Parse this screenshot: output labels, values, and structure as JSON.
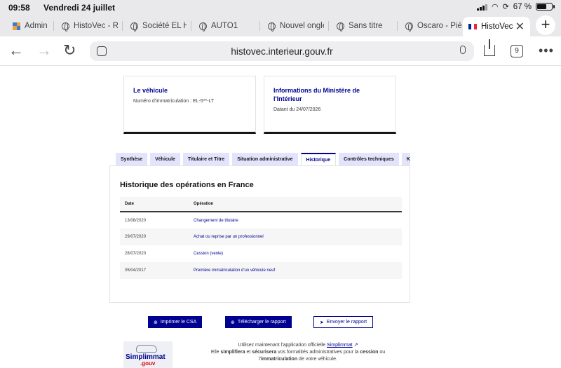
{
  "status_bar": {
    "time": "09:58",
    "date": "Vendredi 24 juillet",
    "battery": "67 %"
  },
  "browser": {
    "tabs": [
      {
        "label": "Admin",
        "icon": "admin-favicon"
      },
      {
        "label": "HistoVec - R",
        "icon": "globe-icon"
      },
      {
        "label": "Société EL H",
        "icon": "globe-icon"
      },
      {
        "label": "AUTO1",
        "icon": "globe-icon"
      },
      {
        "label": "Nouvel ongle",
        "icon": "globe-icon"
      },
      {
        "label": "Sans titre",
        "icon": "globe-icon"
      },
      {
        "label": "Oscaro - Pié",
        "icon": "globe-icon"
      },
      {
        "label": "HistoVec",
        "icon": "french-flag-icon",
        "active": true
      }
    ],
    "url": "histovec.interieur.gouv.fr",
    "tab_count": "9"
  },
  "cards": {
    "vehicle": {
      "title": "Le véhicule",
      "text": "Numéro d'immatriculation : EL-5**-LT"
    },
    "ministry": {
      "title": "Informations du Ministère de l'Intérieur",
      "text": "Datant du 24/07/2026"
    }
  },
  "page_tabs": [
    {
      "label": "Synthèse"
    },
    {
      "label": "Véhicule"
    },
    {
      "label": "Titulaire et Titre"
    },
    {
      "label": "Situation administrative"
    },
    {
      "label": "Historique",
      "active": true
    },
    {
      "label": "Contrôles techniques"
    },
    {
      "label": "Kil"
    }
  ],
  "history": {
    "title": "Historique des opérations en France",
    "headers": {
      "date": "Date",
      "operation": "Opération"
    },
    "rows": [
      {
        "date": "13/08/2020",
        "operation": "Changement de titulaire"
      },
      {
        "date": "29/07/2020",
        "operation": "Achat ou reprise par un professionnel"
      },
      {
        "date": "28/07/2020",
        "operation": "Cession (vente)"
      },
      {
        "date": "05/04/2017",
        "operation": "Première immatriculation d'un véhicule neuf"
      }
    ]
  },
  "actions": {
    "print": "Imprimer le CSA",
    "download": "Télécharger le rapport",
    "send": "Envoyer le rapport"
  },
  "simplimmat": {
    "logo_name": "Simplimmat",
    "logo_sub": ".gouv",
    "line1_prefix": "Utilisez maintenant l'application officielle ",
    "link": "Simplimmat",
    "line2_a": "Elle ",
    "simplify": "simplifiera",
    "line2_b": " et ",
    "secure": "sécurisera",
    "line2_c": " vos formalités administratives pour la ",
    "cession": "cession",
    "line2_d": " ou",
    "line3_a": "l'",
    "immat": "immatriculation",
    "line3_b": " de votre véhicule."
  },
  "colors": {
    "primary": "#000091",
    "tab_bg": "#e3e3fd",
    "chrome": "#e9e9eb"
  }
}
